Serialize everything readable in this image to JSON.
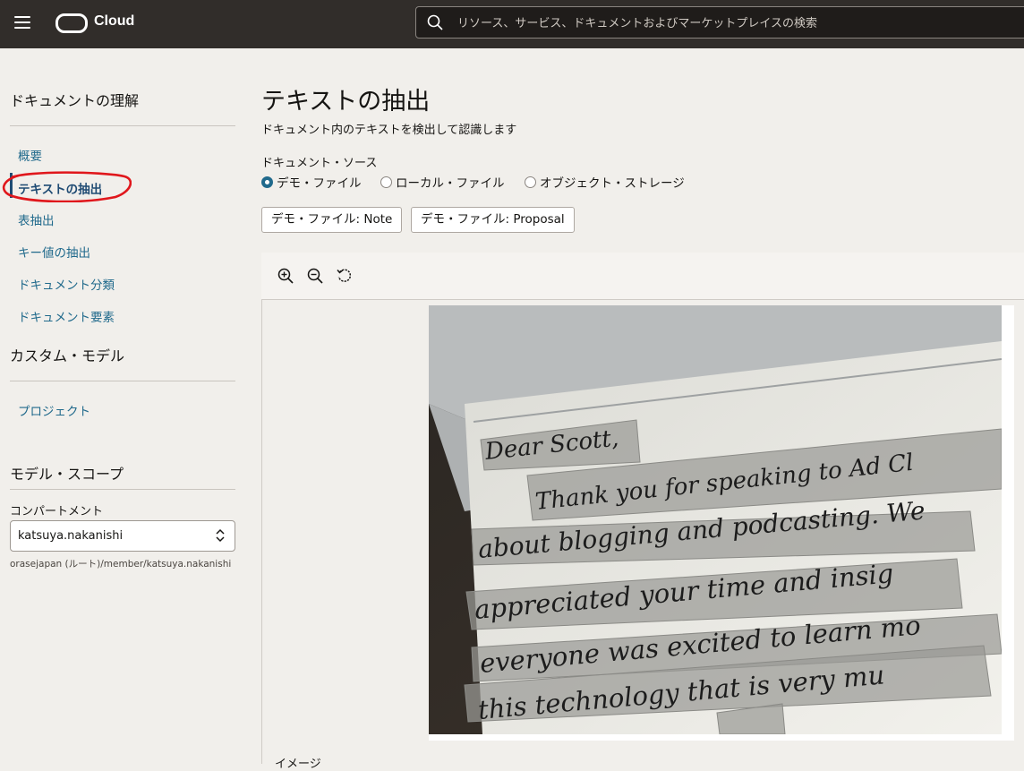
{
  "header": {
    "brand": "Cloud",
    "search_placeholder": "リソース、サービス、ドキュメントおよびマーケットプレイスの検索"
  },
  "sidebar": {
    "section1_title": "ドキュメントの理解",
    "items": [
      {
        "label": "概要"
      },
      {
        "label": "テキストの抽出"
      },
      {
        "label": "表抽出"
      },
      {
        "label": "キー値の抽出"
      },
      {
        "label": "ドキュメント分類"
      },
      {
        "label": "ドキュメント要素"
      }
    ],
    "section2_title": "カスタム・モデル",
    "section2_items": [
      {
        "label": "プロジェクト"
      }
    ],
    "scope_title": "モデル・スコープ",
    "compartment_label": "コンパートメント",
    "compartment_value": "katsuya.nakanishi",
    "compartment_path": "orasejapan (ルート)/member/katsuya.nakanishi"
  },
  "main": {
    "title": "テキストの抽出",
    "description": "ドキュメント内のテキストを検出して認識します",
    "source_label": "ドキュメント・ソース",
    "source_options": [
      {
        "label": "デモ・ファイル",
        "selected": true
      },
      {
        "label": "ローカル・ファイル",
        "selected": false
      },
      {
        "label": "オブジェクト・ストレージ",
        "selected": false
      }
    ],
    "demo_buttons": [
      "デモ・ファイル: Note",
      "デモ・ファイル: Proposal"
    ],
    "image_caption": "イメージ",
    "note_lines": [
      "Dear Scott,",
      "Thank you for speaking to Ad Cl",
      "about blogging and podcasting. We",
      "appreciated your time and insig",
      "everyone was excited to learn mo",
      "this technology that is very mu"
    ]
  },
  "colors": {
    "topbar": "#312d2a",
    "link": "#216a8c",
    "annotation_circle": "#e0171c"
  }
}
